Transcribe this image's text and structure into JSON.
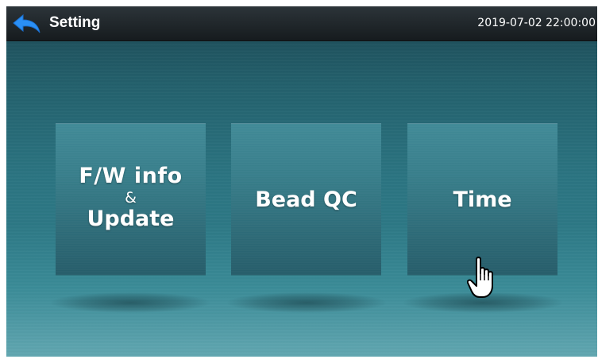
{
  "header": {
    "title": "Setting",
    "datetime": "2019-07-02 22:00:00",
    "back_icon": "back-arrow-icon"
  },
  "tiles": [
    {
      "id": "fw",
      "line1": "F/W info",
      "line2": "&",
      "line3": "Update"
    },
    {
      "id": "bead",
      "label": "Bead QC"
    },
    {
      "id": "time",
      "label": "Time"
    }
  ],
  "cursor_icon": "hand-pointer-icon",
  "colors": {
    "topbar": "#1e2529",
    "accent_blue": "#2a8ff5",
    "background": "#2b7481",
    "tile": "#34798a",
    "text": "#ffffff"
  }
}
